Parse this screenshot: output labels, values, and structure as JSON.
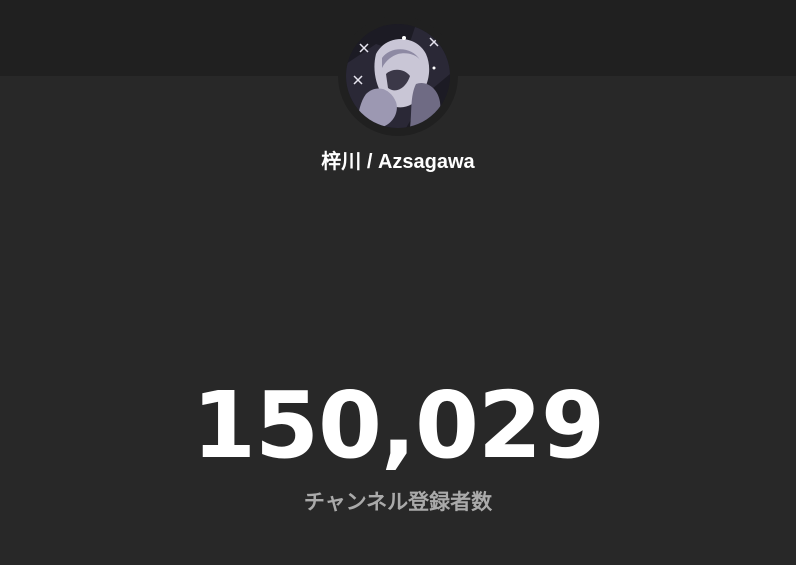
{
  "channel": {
    "name": "梓川 / Azsagawa",
    "avatar_icon": "channel-avatar-icon"
  },
  "counter": {
    "value": "150,029",
    "label": "チャンネル登録者数"
  },
  "colors": {
    "background": "#282828",
    "top_band": "#202020",
    "count_text": "#ffffff",
    "label_text": "#aaaaaa"
  }
}
